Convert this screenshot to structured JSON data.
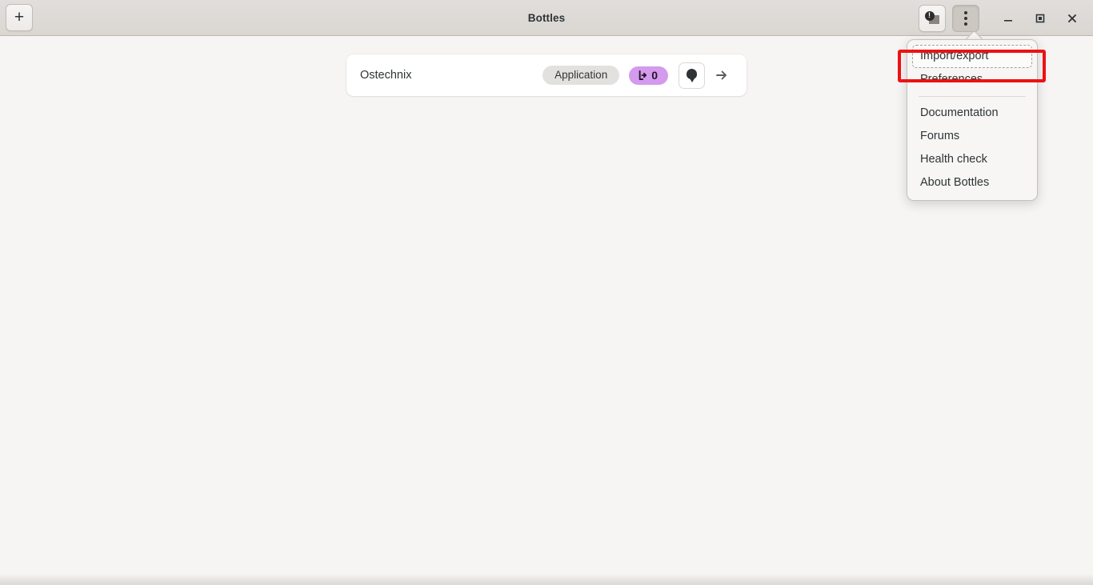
{
  "window": {
    "title": "Bottles",
    "titlebar_buttons": {
      "new_bottle_label": "+",
      "notifications_label": "Notifications",
      "main_menu_label": "Main Menu",
      "minimize_label": "Minimize",
      "maximize_label": "Maximize",
      "close_label": "Close"
    }
  },
  "bottles": [
    {
      "name": "Ostechnix",
      "environment": "Application",
      "programs_count": "0",
      "icon": "balloon-icon",
      "open_label": "Open"
    }
  ],
  "menu": {
    "items": [
      {
        "label": "Import/export",
        "focused": true,
        "name": "menu-item-import-export"
      },
      {
        "label": "Preferences",
        "focused": false,
        "name": "menu-item-preferences"
      },
      {
        "label": "Documentation",
        "focused": false,
        "name": "menu-item-documentation"
      },
      {
        "label": "Forums",
        "focused": false,
        "name": "menu-item-forums"
      },
      {
        "label": "Health check",
        "focused": false,
        "name": "menu-item-health-check"
      },
      {
        "label": "About Bottles",
        "focused": false,
        "name": "menu-item-about-bottles"
      }
    ],
    "separator_after_index": 1
  },
  "annotation": {
    "color": "#ee1111",
    "target": "Import/export"
  },
  "colors": {
    "headerbar": "#dad6d2",
    "content_bg": "#f6f5f4",
    "card_bg": "#ffffff",
    "chip_bg": "#e3e1de",
    "badge_bg": "#d39aed",
    "popover_bg": "#f7f6f5",
    "text": "#2e3436"
  }
}
